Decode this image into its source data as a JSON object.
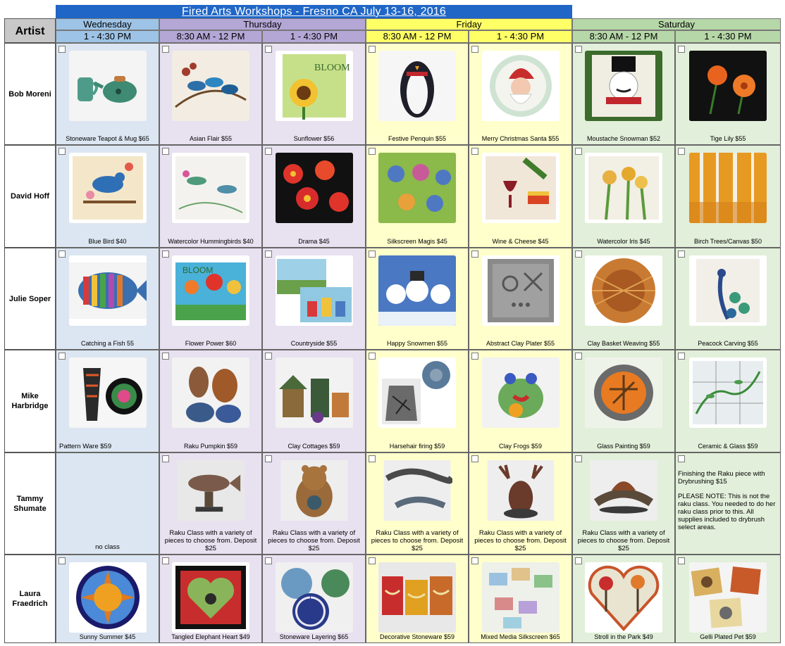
{
  "title": "Fired Arts Workshops - Fresno CA July 13-16, 2016",
  "artist_header": "Artist",
  "days": [
    {
      "name": "Wednesday",
      "color": "#dce6f2",
      "header_color": "#9dc3e6",
      "slots": [
        "1 - 4:30 PM"
      ]
    },
    {
      "name": "Thursday",
      "color": "#e7e1f0",
      "header_color": "#b4a7d6",
      "slots": [
        "8:30 AM - 12 PM",
        "1 - 4:30 PM"
      ]
    },
    {
      "name": "Friday",
      "color": "#ffffcc",
      "header_color": "#ffff66",
      "slots": [
        "8:30 AM - 12 PM",
        "1 - 4:30 PM"
      ]
    },
    {
      "name": "Saturday",
      "color": "#e2efda",
      "header_color": "#b6d7a8",
      "slots": [
        "8:30 AM - 12 PM",
        "1 - 4:30 PM"
      ]
    }
  ],
  "artists": [
    {
      "name": "Bob Moreni",
      "classes": [
        {
          "caption": "Stoneware Teapot & Mug $65",
          "art": "teapot"
        },
        {
          "caption": "Asian Flair $55",
          "art": "birds"
        },
        {
          "caption": "Sunflower $56",
          "art": "sunflower"
        },
        {
          "caption": "Festive Penquin $55",
          "art": "penguin"
        },
        {
          "caption": "Merry Christmas Santa $55",
          "art": "santa"
        },
        {
          "caption": "Moustache Snowman $52",
          "art": "snowman"
        },
        {
          "caption": "Tige Lily $55",
          "art": "lily"
        }
      ]
    },
    {
      "name": "David Hoff",
      "classes": [
        {
          "caption": "Blue Bird $40",
          "art": "bluebird"
        },
        {
          "caption": "Watercolor Hummingbirds $40",
          "art": "hummingbird"
        },
        {
          "caption": "Drama $45",
          "art": "drama"
        },
        {
          "caption": "Silkscreen Magis $45",
          "art": "silkscreen"
        },
        {
          "caption": "Wine & Cheese $45",
          "art": "wine"
        },
        {
          "caption": "Watercolor Iris $45",
          "art": "iris"
        },
        {
          "caption": "Birch Trees/Canvas $50",
          "art": "birch"
        }
      ]
    },
    {
      "name": "Julie Soper",
      "classes": [
        {
          "caption": "Catching a Fish 55",
          "art": "fish"
        },
        {
          "caption": "Flower Power $60",
          "art": "flowerpower"
        },
        {
          "caption": "Countryside $55",
          "art": "countryside"
        },
        {
          "caption": "Happy Snowmen $55",
          "art": "snowmen"
        },
        {
          "caption": "Abstract Clay Plater $55",
          "art": "clayplate"
        },
        {
          "caption": "Clay Basket Weaving $55",
          "art": "basket"
        },
        {
          "caption": "Peacock Carving $55",
          "art": "peacock"
        }
      ]
    },
    {
      "name": "Mike Harbridge",
      "classes": [
        {
          "caption": "Pattern Ware $59",
          "art": "patternware"
        },
        {
          "caption": "Raku Pumpkin $59",
          "art": "pumpkin"
        },
        {
          "caption": "Clay Cottages $59",
          "art": "cottages"
        },
        {
          "caption": "Harsehair firing $59",
          "art": "horsehair"
        },
        {
          "caption": "Clay Frogs $59",
          "art": "frog"
        },
        {
          "caption": "Glass Painting  $59",
          "art": "glass"
        },
        {
          "caption": "Ceramic & Glass  $59",
          "art": "ceramicglass"
        }
      ]
    },
    {
      "name": "Tammy Shumate",
      "classes": [
        {
          "caption": "no class",
          "art": "none"
        },
        {
          "caption": "Raku Class with a variety of pieces to choose from. Deposit $25",
          "art": "rakufish"
        },
        {
          "caption": "Raku Class with a variety of pieces to choose from. Deposit $25",
          "art": "rakubear"
        },
        {
          "caption": "Raku Class with a variety of pieces to choose from. Deposit $25",
          "art": "rakulizard"
        },
        {
          "caption": "Raku Class with a variety of pieces to choose from. Deposit $25",
          "art": "rakumoose"
        },
        {
          "caption": "Raku Class with a variety of pieces to choose from. Deposit $25",
          "art": "rakudino"
        },
        {
          "caption": "Finishing the Raku piece with Drybrushing $15",
          "note": "PLEASE NOTE: This is not the raku class. You needed to do her raku class prior to this. All supplies included to drybrush select areas.",
          "art": "none"
        }
      ]
    },
    {
      "name": "Laura Fraedrich",
      "classes": [
        {
          "caption": "Sunny Summer $45",
          "art": "sun"
        },
        {
          "caption": "Tangled Elephant Heart $49",
          "art": "heart"
        },
        {
          "caption": "Stoneware Layering $65",
          "art": "layering"
        },
        {
          "caption": "Decorative Stoneware $59",
          "art": "decorative"
        },
        {
          "caption": "Mixed Media Silkscreen $65",
          "art": "mixedmedia"
        },
        {
          "caption": "Stroll in the Park $49",
          "art": "stroll"
        },
        {
          "caption": "Gelli Plated Pet $59",
          "art": "gelli"
        }
      ]
    }
  ]
}
